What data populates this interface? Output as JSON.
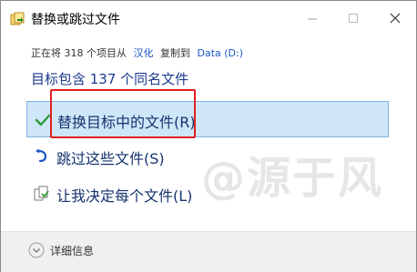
{
  "window": {
    "title": "替换或跳过文件"
  },
  "status": {
    "prefix": "正在将 318 个项目从",
    "source": "汉化",
    "middle": "复制到",
    "destination": "Data (D:)"
  },
  "heading": "目标包含 137 个同名文件",
  "options": {
    "replace": {
      "label": "替换目标中的文件(R)",
      "icon": "check-icon"
    },
    "skip": {
      "label": "跳过这些文件(S)",
      "icon": "skip-arrow-icon"
    },
    "decide": {
      "label": "让我决定每个文件(L)",
      "icon": "documents-icon"
    }
  },
  "footer": {
    "details_label": "详细信息"
  },
  "watermark": "@源于风",
  "colors": {
    "accent": "#1a56c4",
    "selected_bg": "#cfe6f8",
    "highlight": "#e02020"
  }
}
